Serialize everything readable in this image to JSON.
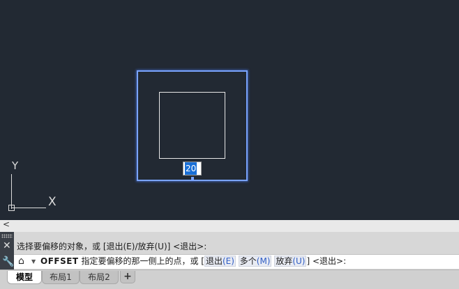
{
  "canvas": {
    "ucs": {
      "x_label": "X",
      "y_label": "Y"
    },
    "dynamic_input": {
      "value": "20"
    }
  },
  "command": {
    "scroll_left": "<",
    "history_line": "选择要偏移的对象，或 [退出(E)/放弃(U)] <退出>:",
    "close_symbol": "✕",
    "wrench_symbol": "🔧",
    "prompt": {
      "command_name": "OFFSET",
      "text": "指定要偏移的那一侧上的点，或 [",
      "opt1_label": "退出",
      "opt1_key": "(E)",
      "opt2_label": "多个",
      "opt2_key": "(M)",
      "opt3_label": "放弃",
      "opt3_key": "(U)",
      "suffix": "] <退出>:"
    }
  },
  "tabs": {
    "items": [
      {
        "label": "模型"
      },
      {
        "label": "布局1"
      },
      {
        "label": "布局2"
      }
    ],
    "add_label": "+"
  },
  "colors": {
    "canvas_bg": "#222933",
    "selection_outline": "#7aa4ff",
    "option_key": "#2f5dc4"
  }
}
